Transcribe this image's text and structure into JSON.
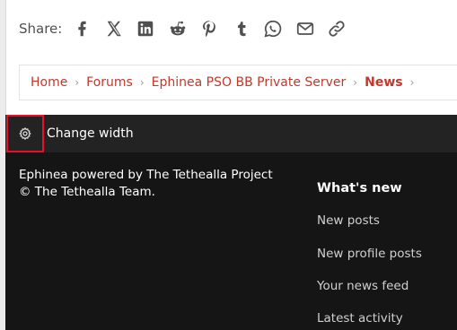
{
  "share": {
    "label": "Share:",
    "icons": [
      "facebook-icon",
      "x-icon",
      "linkedin-icon",
      "reddit-icon",
      "pinterest-icon",
      "tumblr-icon",
      "whatsapp-icon",
      "email-icon",
      "link-icon"
    ]
  },
  "breadcrumb": {
    "items": [
      "Home",
      "Forums",
      "Ephinea PSO BB Private Server",
      "News"
    ],
    "separator": "›"
  },
  "footer": {
    "change_width_label": "Change width",
    "copyright": "Ephinea powered by The Tethealla Project © The Tethealla Team.",
    "whats_new": {
      "heading": "What's new",
      "links": [
        "New posts",
        "New profile posts",
        "Your news feed",
        "Latest activity"
      ]
    }
  },
  "colors": {
    "breadcrumb_link": "#c0392b",
    "footer_bar": "#232323",
    "footer_main": "#151515",
    "highlight_box": "#e8112d"
  }
}
